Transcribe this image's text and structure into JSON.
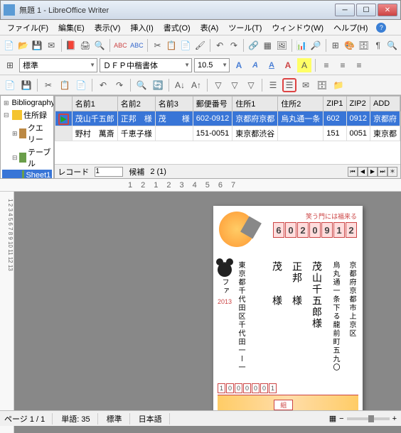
{
  "window": {
    "title": "無題 1 - LibreOffice Writer"
  },
  "menu": {
    "file": "ファイル(F)",
    "edit": "編集(E)",
    "view": "表示(V)",
    "insert": "挿入(I)",
    "format": "書式(O)",
    "table": "表(A)",
    "tools": "ツール(T)",
    "window": "ウィンドウ(W)",
    "help": "ヘルプ(H)"
  },
  "toolbar2": {
    "style": "標準",
    "font": "ＤＦＰ中楷書体",
    "size": "10.5"
  },
  "tree": {
    "bibliography": "Bibliography",
    "addressbook": "住所録",
    "query": "クエリー",
    "tables": "テーブル",
    "sheet1": "Sheet1"
  },
  "grid": {
    "headers": [
      "名前1",
      "名前2",
      "名前3",
      "郵便番号",
      "住所1",
      "住所2",
      "ZIP1",
      "ZIP2",
      "ADD"
    ],
    "rows": [
      {
        "n1": "茂山千五郎",
        "n2": "正邦　様",
        "n3": "茂　　様",
        "zip": "602-0912",
        "a1": "京都府京都",
        "a2": "烏丸通一条",
        "z1": "602",
        "z2": "0912",
        "ad": "京都府"
      },
      {
        "n1": "野村　萬斎",
        "n2": "千恵子様",
        "n3": "",
        "zip": "151-0051",
        "a1": "東京都渋谷",
        "a2": "",
        "z1": "151",
        "z2": "0051",
        "ad": "東京都"
      }
    ]
  },
  "nav": {
    "record": "レコード",
    "recno": "1",
    "filter": "候補",
    "count": "2 (1)"
  },
  "postcard": {
    "greeting": "笑う門には福来る",
    "zip": [
      "6",
      "0",
      "2",
      "0",
      "9",
      "1",
      "2"
    ],
    "addr1": "京都府京都市上京区",
    "addr2": "烏丸通一条下る龍前町五九〇",
    "name1": "茂山千五郎様",
    "name2": "正邦　様",
    "name3": "茂　　様",
    "year": "2013",
    "senderaddr": "東京都千代田区千代田一ー一",
    "sendername": "アルファ",
    "senderzip": [
      "1",
      "0",
      "0",
      "0",
      "0",
      "0",
      "1"
    ],
    "btmlabel": "組"
  },
  "status": {
    "page": "ページ 1 / 1",
    "words": "単語: 35",
    "style": "標準",
    "lang": "日本語"
  },
  "ruler": [
    "1",
    "2",
    "1",
    "2",
    "3",
    "4",
    "5",
    "6",
    "7",
    "8",
    "9"
  ]
}
